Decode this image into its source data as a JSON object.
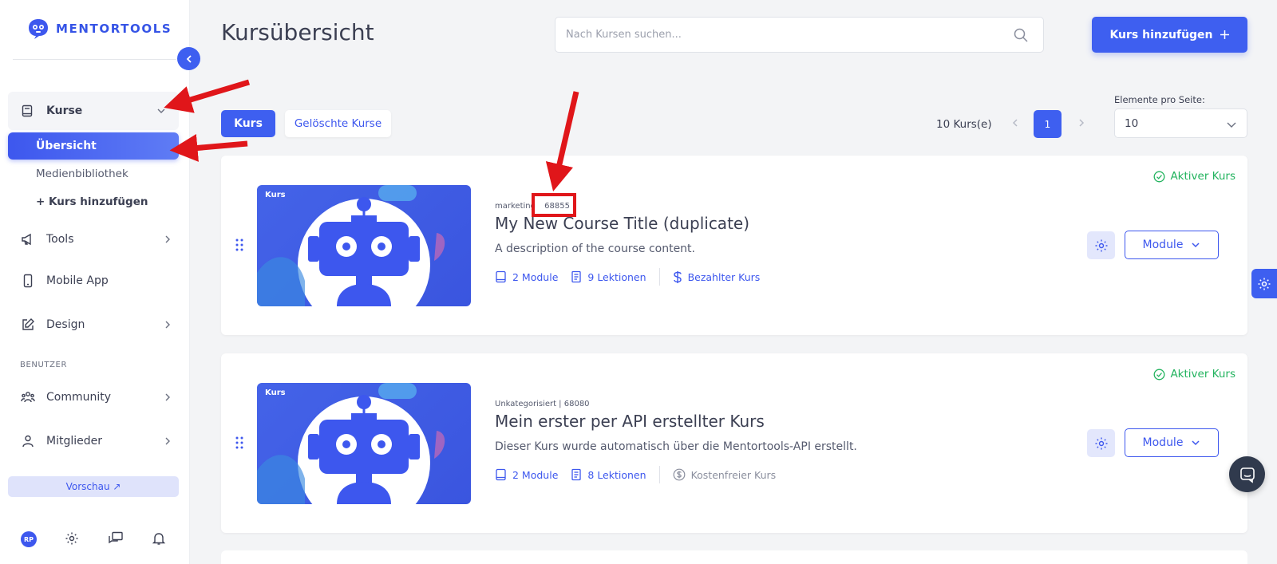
{
  "brand": {
    "name": "MENTORTOOLS",
    "accent": "#3e5ff0"
  },
  "sidebar": {
    "kurse": "Kurse",
    "sub_items": [
      "Übersicht",
      "Medienbibliothek",
      "+ Kurs hinzufügen"
    ],
    "items": [
      {
        "label": "Tools"
      },
      {
        "label": "Mobile App"
      },
      {
        "label": "Design"
      },
      {
        "label": "Community"
      },
      {
        "label": "Mitglieder"
      }
    ],
    "section_label": "BENUTZER",
    "preview": "Vorschau ↗",
    "avatar": "RP"
  },
  "header": {
    "title": "Kursübersicht",
    "search_placeholder": "Nach Kursen suchen...",
    "add_button": "Kurs hinzufügen"
  },
  "toolbar": {
    "tab_active": "Kurs",
    "tab_deleted": "Gelöschte Kurse",
    "count": "10 Kurs(e)",
    "page": "1",
    "per_page_label": "Elemente pro Seite:",
    "per_page_value": "10"
  },
  "courses": [
    {
      "status": "Aktiver Kurs",
      "tag": "Kurs",
      "category": "marketing",
      "id": "68855",
      "title": "My New Course Title (duplicate)",
      "description": "A description of the course content.",
      "modules": "2 Module",
      "lessons": "9 Lektionen",
      "pricing": "Bezahlter Kurs",
      "module_button": "Module"
    },
    {
      "status": "Aktiver Kurs",
      "tag": "Kurs",
      "meta": "Unkategorisiert | 68080",
      "title": "Mein erster per API erstellter Kurs",
      "description": "Dieser Kurs wurde automatisch über die Mentortools-API erstellt.",
      "modules": "2 Module",
      "lessons": "8 Lektionen",
      "pricing": "Kostenfreier Kurs",
      "module_button": "Module"
    }
  ]
}
